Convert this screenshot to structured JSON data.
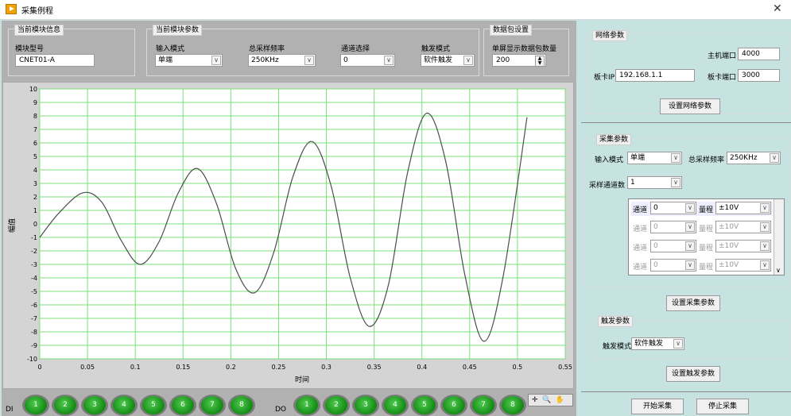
{
  "window": {
    "title": "采集例程",
    "close": "✕"
  },
  "module_info": {
    "group_title": "当前模块信息",
    "model_label": "模块型号",
    "model_value": "CNET01-A"
  },
  "module_params": {
    "group_title": "当前模块参数",
    "input_mode_label": "输入模式",
    "input_mode_value": "单端",
    "sample_rate_label": "总采样频率",
    "sample_rate_value": "250KHz",
    "channel_label": "通道选择",
    "channel_value": "0",
    "trigger_label": "触发模式",
    "trigger_value": "软件触发"
  },
  "packet": {
    "group_title": "数据包设置",
    "count_label": "单屏显示数据包数量",
    "count_value": "200"
  },
  "graph": {
    "y_ticks": [
      "10",
      "9",
      "8",
      "7",
      "6",
      "5",
      "4",
      "3",
      "2",
      "1",
      "0",
      "-1",
      "-2",
      "-3",
      "-4",
      "-5",
      "-6",
      "-7",
      "-8",
      "-9",
      "-10"
    ],
    "x_ticks": [
      "0",
      "0.05",
      "0.1",
      "0.15",
      "0.2",
      "0.25",
      "0.3",
      "0.35",
      "0.4",
      "0.45",
      "0.5",
      "0.55"
    ],
    "xlabel": "时间",
    "ylabel": "幅值"
  },
  "chart_data": {
    "type": "line",
    "xlabel": "时间",
    "ylabel": "幅值",
    "xlim": [
      0,
      0.55
    ],
    "ylim": [
      -10,
      10
    ],
    "grid": true,
    "series": [
      {
        "x": [
          0,
          0.02,
          0.045,
          0.065,
          0.085,
          0.105,
          0.125,
          0.145,
          0.165,
          0.185,
          0.205,
          0.225,
          0.245,
          0.265,
          0.285,
          0.305,
          0.325,
          0.345,
          0.365,
          0.385,
          0.405,
          0.425,
          0.445,
          0.465,
          0.485,
          0.51
        ],
        "y": [
          -1.0,
          0.8,
          2.3,
          1.6,
          -1.2,
          -3.0,
          -1.3,
          2.3,
          4.1,
          1.5,
          -3.3,
          -5.1,
          -2.1,
          3.5,
          6.1,
          2.8,
          -4.0,
          -7.6,
          -4.5,
          3.8,
          8.2,
          4.6,
          -3.8,
          -8.7,
          -3.9,
          7.9
        ]
      }
    ]
  },
  "tools": {
    "crosshair": "✛",
    "zoom": "🔍",
    "pan": "✋"
  },
  "di": {
    "label": "DI",
    "leds": [
      "1",
      "2",
      "3",
      "4",
      "5",
      "6",
      "7",
      "8"
    ]
  },
  "do": {
    "label": "DO",
    "leds": [
      "1",
      "2",
      "3",
      "4",
      "5",
      "6",
      "7",
      "8"
    ]
  },
  "net": {
    "group_title": "网络参数",
    "host_port_label": "主机端口",
    "host_port_value": "4000",
    "card_ip_label": "板卡IP",
    "card_ip_value": "192.168.1.1",
    "card_port_label": "板卡端口",
    "card_port_value": "3000",
    "set_button": "设置网络参数"
  },
  "acq": {
    "group_title": "采集参数",
    "input_mode_label": "输入模式",
    "input_mode_value": "单端",
    "sample_rate_label": "总采样频率",
    "sample_rate_value": "250KHz",
    "channel_count_label": "采样通道数",
    "channel_count_value": "1",
    "rows": [
      {
        "ch_label": "通道",
        "ch_value": "0",
        "range_label": "量程",
        "range_value": "±10V"
      },
      {
        "ch_label": "通道",
        "ch_value": "0",
        "range_label": "量程",
        "range_value": "±10V"
      },
      {
        "ch_label": "通道",
        "ch_value": "0",
        "range_label": "量程",
        "range_value": "±10V"
      },
      {
        "ch_label": "通道",
        "ch_value": "0",
        "range_label": "量程",
        "range_value": "±10V"
      }
    ],
    "set_button": "设置采集参数"
  },
  "trigger": {
    "group_title": "触发参数",
    "mode_label": "触发模式",
    "mode_value": "软件触发",
    "set_button": "设置触发参数"
  },
  "actions": {
    "start": "开始采集",
    "stop": "停止采集"
  }
}
